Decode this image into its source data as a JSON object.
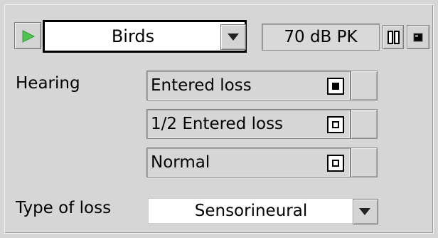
{
  "player": {
    "play_icon": "play-icon",
    "play_color": "#4fc34f",
    "sound": "Birds",
    "level": "70 dB PK",
    "pause_icon": "pause-icon",
    "stop_icon": "stop-icon"
  },
  "hearing": {
    "label": "Hearing",
    "options": [
      {
        "label": "Entered loss",
        "selected": true
      },
      {
        "label": "1/2 Entered loss",
        "selected": false
      },
      {
        "label": "Normal",
        "selected": false
      }
    ]
  },
  "type_of_loss": {
    "label": "Type of loss",
    "value": "Sensorineural"
  }
}
